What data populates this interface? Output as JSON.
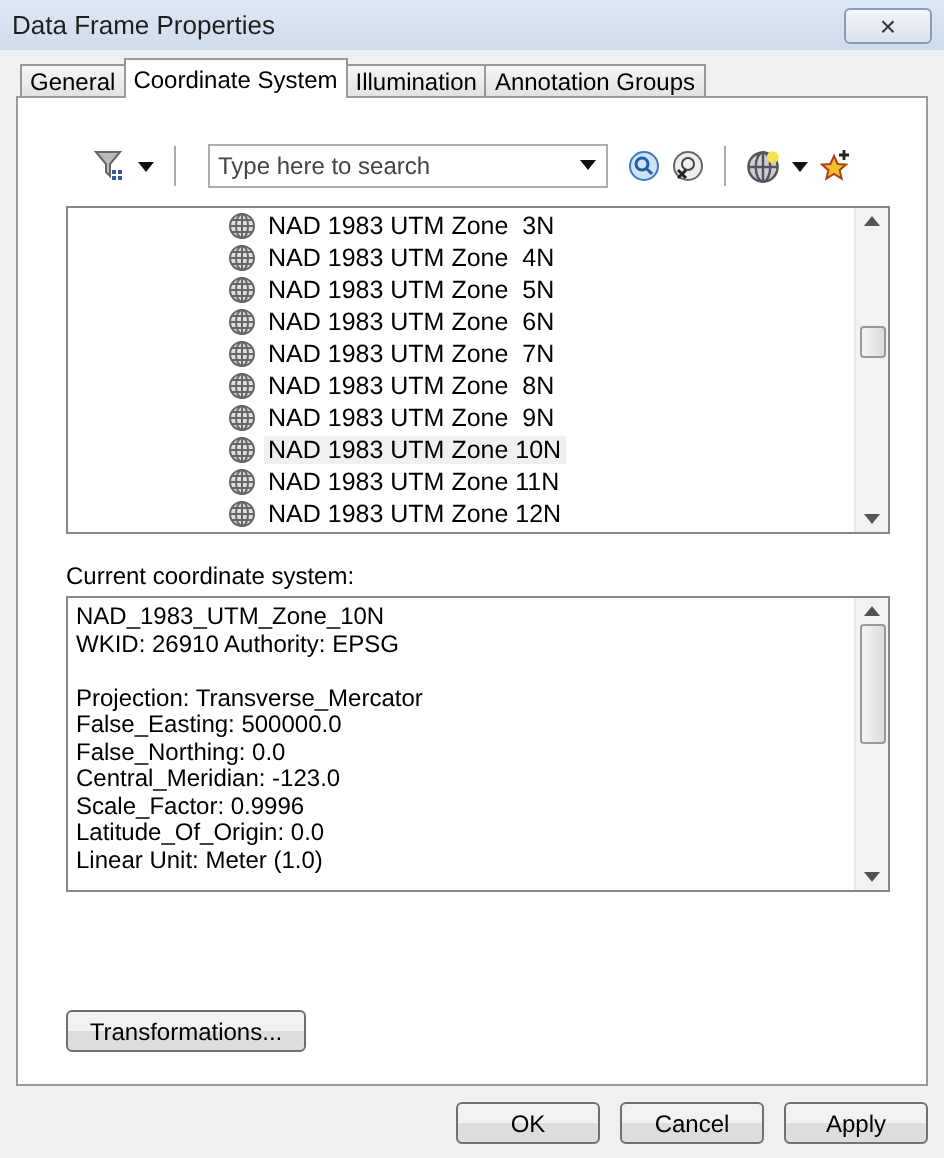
{
  "window": {
    "title": "Data Frame Properties",
    "close": "×"
  },
  "tabs": [
    {
      "label": "General",
      "selected": false
    },
    {
      "label": "Coordinate System",
      "selected": true
    },
    {
      "label": "Illumination",
      "selected": false
    },
    {
      "label": "Annotation Groups",
      "selected": false
    }
  ],
  "search": {
    "placeholder": "Type here to search"
  },
  "systems": [
    {
      "label": "NAD 1983 UTM Zone  3N",
      "selected": false
    },
    {
      "label": "NAD 1983 UTM Zone  4N",
      "selected": false
    },
    {
      "label": "NAD 1983 UTM Zone  5N",
      "selected": false
    },
    {
      "label": "NAD 1983 UTM Zone  6N",
      "selected": false
    },
    {
      "label": "NAD 1983 UTM Zone  7N",
      "selected": false
    },
    {
      "label": "NAD 1983 UTM Zone  8N",
      "selected": false
    },
    {
      "label": "NAD 1983 UTM Zone  9N",
      "selected": false
    },
    {
      "label": "NAD 1983 UTM Zone 10N",
      "selected": true
    },
    {
      "label": "NAD 1983 UTM Zone 11N",
      "selected": false
    },
    {
      "label": "NAD 1983 UTM Zone 12N",
      "selected": false
    }
  ],
  "current_label": "Current coordinate system:",
  "details": [
    [
      "NAD_1983_UTM_Zone_10N",
      "WKID: 26910 Authority: EPSG"
    ],
    [
      "Projection: Transverse_Mercator",
      "False_Easting: 500000.0",
      "False_Northing: 0.0",
      "Central_Meridian: -123.0",
      "Scale_Factor: 0.9996",
      "Latitude_Of_Origin: 0.0",
      "Linear Unit: Meter (1.0)"
    ]
  ],
  "transform_button": "Transformations...",
  "buttons": [
    "OK",
    "Cancel",
    "Apply"
  ]
}
